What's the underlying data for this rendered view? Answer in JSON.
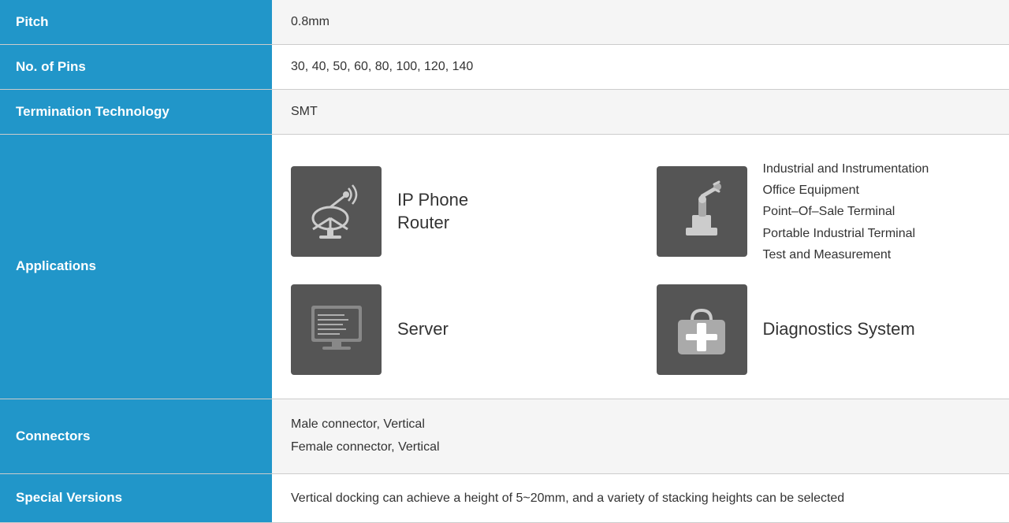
{
  "rows": {
    "pitch": {
      "label": "Pitch",
      "value": "0.8mm"
    },
    "no_of_pins": {
      "label": "No. of Pins",
      "value": "30, 40, 50, 60, 80, 100, 120, 140"
    },
    "termination_technology": {
      "label": "Termination Technology",
      "value": "SMT"
    },
    "applications": {
      "label": "Applications",
      "items": [
        {
          "icon": "satellite",
          "label": "IP Phone\nRouter"
        },
        {
          "icon": "industrial",
          "label_multi": "Industrial and Instrumentation\nOffice Equipment\nPoint–Of–Sale Terminal\nPortable Industrial Terminal\nTest and Measurement"
        },
        {
          "icon": "server",
          "label": "Server"
        },
        {
          "icon": "diagnostics",
          "label": "Diagnostics System"
        }
      ]
    },
    "connectors": {
      "label": "Connectors",
      "lines": [
        "Male connector, Vertical",
        "Female connector, Vertical"
      ]
    },
    "special_versions": {
      "label": "Special Versions",
      "value": "Vertical docking can achieve a height of 5~20mm, and a variety of stacking heights can be selected"
    }
  }
}
